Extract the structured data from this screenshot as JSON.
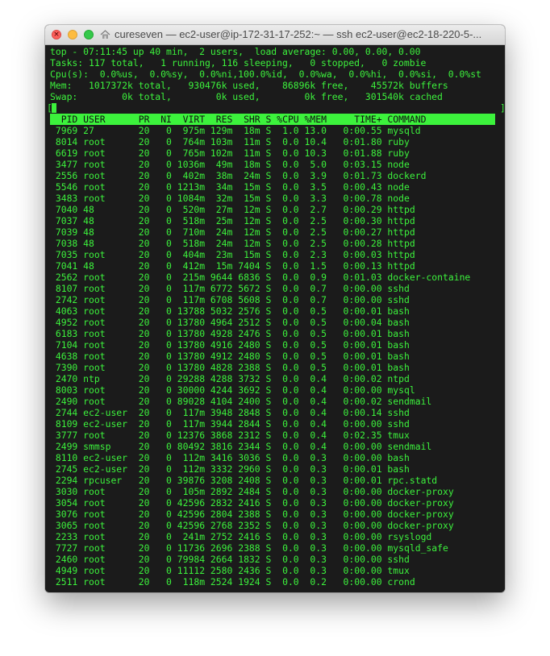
{
  "window": {
    "title": "cureseven — ec2-user@ip-172-31-17-252:~ — ssh ec2-user@ec2-18-220-5-..."
  },
  "icons": {
    "close": "close-icon",
    "title": "home-folder-icon"
  },
  "colors": {
    "terminal_bg": "#1b1b1b",
    "terminal_fg": "#3cf23c",
    "header_bg": "#3cf23c",
    "header_fg": "#111111"
  },
  "summary": {
    "uptime": "top - 07:11:45 up 40 min,  2 users,  load average: 0.00, 0.00, 0.00",
    "tasks": "Tasks: 117 total,   1 running, 116 sleeping,   0 stopped,   0 zombie",
    "cpu": "Cpu(s):  0.0%us,  0.0%sy,  0.0%ni,100.0%id,  0.0%wa,  0.0%hi,  0.0%si,  0.0%st",
    "mem": "Mem:   1017372k total,   930476k used,    86896k free,    45572k buffers",
    "swap": "Swap:        0k total,        0k used,        0k free,   301540k cached"
  },
  "columns": [
    "PID",
    "USER",
    "PR",
    "NI",
    "VIRT",
    "RES",
    "SHR",
    "S",
    "%CPU",
    "%MEM",
    "TIME+",
    "COMMAND"
  ],
  "processes": [
    [
      "7969",
      "27",
      "20",
      "0",
      "975m",
      "129m",
      "18m",
      "S",
      "1.0",
      "13.0",
      "0:00.55",
      "mysqld"
    ],
    [
      "8014",
      "root",
      "20",
      "0",
      "764m",
      "103m",
      "11m",
      "S",
      "0.0",
      "10.4",
      "0:01.80",
      "ruby"
    ],
    [
      "6619",
      "root",
      "20",
      "0",
      "765m",
      "102m",
      "11m",
      "S",
      "0.0",
      "10.3",
      "0:01.88",
      "ruby"
    ],
    [
      "3477",
      "root",
      "20",
      "0",
      "1036m",
      "49m",
      "18m",
      "S",
      "0.0",
      "5.0",
      "0:03.15",
      "node"
    ],
    [
      "2556",
      "root",
      "20",
      "0",
      "402m",
      "38m",
      "24m",
      "S",
      "0.0",
      "3.9",
      "0:01.73",
      "dockerd"
    ],
    [
      "5546",
      "root",
      "20",
      "0",
      "1213m",
      "34m",
      "15m",
      "S",
      "0.0",
      "3.5",
      "0:00.43",
      "node"
    ],
    [
      "3483",
      "root",
      "20",
      "0",
      "1084m",
      "32m",
      "15m",
      "S",
      "0.0",
      "3.3",
      "0:00.78",
      "node"
    ],
    [
      "7040",
      "48",
      "20",
      "0",
      "520m",
      "27m",
      "12m",
      "S",
      "0.0",
      "2.7",
      "0:00.29",
      "httpd"
    ],
    [
      "7037",
      "48",
      "20",
      "0",
      "518m",
      "25m",
      "12m",
      "S",
      "0.0",
      "2.5",
      "0:00.30",
      "httpd"
    ],
    [
      "7039",
      "48",
      "20",
      "0",
      "710m",
      "24m",
      "12m",
      "S",
      "0.0",
      "2.5",
      "0:00.27",
      "httpd"
    ],
    [
      "7038",
      "48",
      "20",
      "0",
      "518m",
      "24m",
      "12m",
      "S",
      "0.0",
      "2.5",
      "0:00.28",
      "httpd"
    ],
    [
      "7035",
      "root",
      "20",
      "0",
      "404m",
      "23m",
      "15m",
      "S",
      "0.0",
      "2.3",
      "0:00.03",
      "httpd"
    ],
    [
      "7041",
      "48",
      "20",
      "0",
      "412m",
      "15m",
      "7404",
      "S",
      "0.0",
      "1.5",
      "0:00.13",
      "httpd"
    ],
    [
      "2562",
      "root",
      "20",
      "0",
      "215m",
      "9644",
      "6836",
      "S",
      "0.0",
      "0.9",
      "0:01.03",
      "docker-containe"
    ],
    [
      "8107",
      "root",
      "20",
      "0",
      "117m",
      "6772",
      "5672",
      "S",
      "0.0",
      "0.7",
      "0:00.00",
      "sshd"
    ],
    [
      "2742",
      "root",
      "20",
      "0",
      "117m",
      "6708",
      "5608",
      "S",
      "0.0",
      "0.7",
      "0:00.00",
      "sshd"
    ],
    [
      "4063",
      "root",
      "20",
      "0",
      "13788",
      "5032",
      "2576",
      "S",
      "0.0",
      "0.5",
      "0:00.01",
      "bash"
    ],
    [
      "4952",
      "root",
      "20",
      "0",
      "13780",
      "4964",
      "2512",
      "S",
      "0.0",
      "0.5",
      "0:00.04",
      "bash"
    ],
    [
      "6183",
      "root",
      "20",
      "0",
      "13780",
      "4928",
      "2476",
      "S",
      "0.0",
      "0.5",
      "0:00.01",
      "bash"
    ],
    [
      "7104",
      "root",
      "20",
      "0",
      "13780",
      "4916",
      "2480",
      "S",
      "0.0",
      "0.5",
      "0:00.01",
      "bash"
    ],
    [
      "4638",
      "root",
      "20",
      "0",
      "13780",
      "4912",
      "2480",
      "S",
      "0.0",
      "0.5",
      "0:00.01",
      "bash"
    ],
    [
      "7390",
      "root",
      "20",
      "0",
      "13780",
      "4828",
      "2388",
      "S",
      "0.0",
      "0.5",
      "0:00.01",
      "bash"
    ],
    [
      "2470",
      "ntp",
      "20",
      "0",
      "29288",
      "4288",
      "3732",
      "S",
      "0.0",
      "0.4",
      "0:00.02",
      "ntpd"
    ],
    [
      "8003",
      "root",
      "20",
      "0",
      "30000",
      "4244",
      "3692",
      "S",
      "0.0",
      "0.4",
      "0:00.00",
      "mysql"
    ],
    [
      "2490",
      "root",
      "20",
      "0",
      "89028",
      "4104",
      "2400",
      "S",
      "0.0",
      "0.4",
      "0:00.02",
      "sendmail"
    ],
    [
      "2744",
      "ec2-user",
      "20",
      "0",
      "117m",
      "3948",
      "2848",
      "S",
      "0.0",
      "0.4",
      "0:00.14",
      "sshd"
    ],
    [
      "8109",
      "ec2-user",
      "20",
      "0",
      "117m",
      "3944",
      "2844",
      "S",
      "0.0",
      "0.4",
      "0:00.00",
      "sshd"
    ],
    [
      "3777",
      "root",
      "20",
      "0",
      "12376",
      "3868",
      "2312",
      "S",
      "0.0",
      "0.4",
      "0:02.35",
      "tmux"
    ],
    [
      "2499",
      "smmsp",
      "20",
      "0",
      "80492",
      "3816",
      "2344",
      "S",
      "0.0",
      "0.4",
      "0:00.00",
      "sendmail"
    ],
    [
      "8110",
      "ec2-user",
      "20",
      "0",
      "112m",
      "3416",
      "3036",
      "S",
      "0.0",
      "0.3",
      "0:00.00",
      "bash"
    ],
    [
      "2745",
      "ec2-user",
      "20",
      "0",
      "112m",
      "3332",
      "2960",
      "S",
      "0.0",
      "0.3",
      "0:00.01",
      "bash"
    ],
    [
      "2294",
      "rpcuser",
      "20",
      "0",
      "39876",
      "3208",
      "2408",
      "S",
      "0.0",
      "0.3",
      "0:00.01",
      "rpc.statd"
    ],
    [
      "3030",
      "root",
      "20",
      "0",
      "105m",
      "2892",
      "2484",
      "S",
      "0.0",
      "0.3",
      "0:00.00",
      "docker-proxy"
    ],
    [
      "3054",
      "root",
      "20",
      "0",
      "42596",
      "2832",
      "2416",
      "S",
      "0.0",
      "0.3",
      "0:00.00",
      "docker-proxy"
    ],
    [
      "3076",
      "root",
      "20",
      "0",
      "42596",
      "2804",
      "2388",
      "S",
      "0.0",
      "0.3",
      "0:00.00",
      "docker-proxy"
    ],
    [
      "3065",
      "root",
      "20",
      "0",
      "42596",
      "2768",
      "2352",
      "S",
      "0.0",
      "0.3",
      "0:00.00",
      "docker-proxy"
    ],
    [
      "2233",
      "root",
      "20",
      "0",
      "241m",
      "2752",
      "2416",
      "S",
      "0.0",
      "0.3",
      "0:00.00",
      "rsyslogd"
    ],
    [
      "7727",
      "root",
      "20",
      "0",
      "11736",
      "2696",
      "2388",
      "S",
      "0.0",
      "0.3",
      "0:00.00",
      "mysqld_safe"
    ],
    [
      "2460",
      "root",
      "20",
      "0",
      "79984",
      "2664",
      "1832",
      "S",
      "0.0",
      "0.3",
      "0:00.00",
      "sshd"
    ],
    [
      "4949",
      "root",
      "20",
      "0",
      "11112",
      "2580",
      "2436",
      "S",
      "0.0",
      "0.3",
      "0:00.00",
      "tmux"
    ],
    [
      "2511",
      "root",
      "20",
      "0",
      "118m",
      "2524",
      "1924",
      "S",
      "0.0",
      "0.2",
      "0:00.00",
      "crond"
    ]
  ]
}
